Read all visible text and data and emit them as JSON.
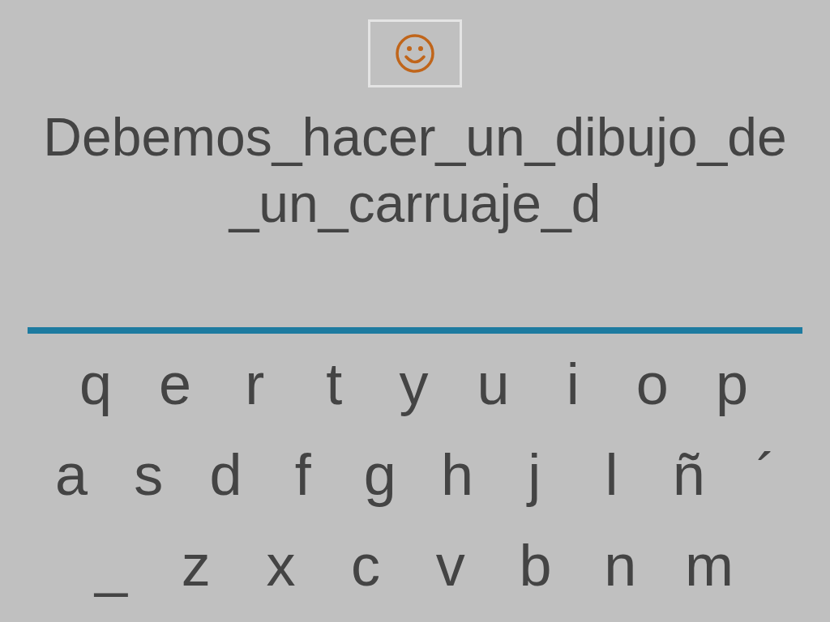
{
  "sentence": "Debemos_hacer_un_dibujo_de_un_carruaje_d",
  "keyboard": {
    "rows": [
      {
        "keys": [
          "q",
          "e",
          "r",
          "t",
          "y",
          "u",
          "i",
          "o",
          "p"
        ]
      },
      {
        "keys": [
          "a",
          "s",
          "d",
          "f",
          "g",
          "h",
          "j",
          "l",
          "ñ",
          "´"
        ]
      },
      {
        "keys": [
          "_",
          "z",
          "x",
          "c",
          "v",
          "b",
          "n",
          "m"
        ]
      }
    ]
  }
}
